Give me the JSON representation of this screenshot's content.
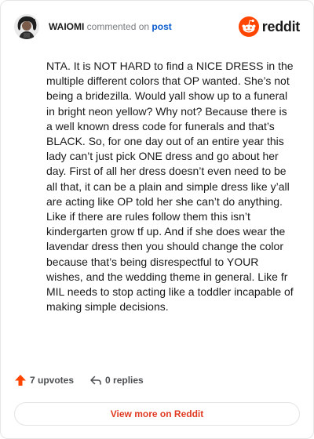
{
  "comment": {
    "author": "WAIOMI",
    "action": "commented on",
    "post_link": "post",
    "body": "NTA. It is NOT HARD to find a NICE DRESS in the multiple different colors that OP wanted. She’s not being a bridezilla. Would yall show up to a funeral in bright neon yellow? Why not? Because there is a well known dress code for funerals and that’s BLACK. So, for one day out of an entire year this lady can’t just pick ONE dress and go about her day. First of all her dress doesn’t even need to be all that, it can be a plain and simple dress like y’all are acting like OP told her she can’t do anything. Like if there are rules follow them this isn’t kindergarten grow tf up. And if she does wear the lavendar dress then you should change the color because that’s being disrespectful to YOUR wishes, and the wedding theme in general. Like fr MIL needs to stop acting like a toddler incapable of making simple decisions."
  },
  "brand": {
    "name": "reddit",
    "accent": "#ff4500"
  },
  "footer": {
    "upvotes": "7 upvotes",
    "replies": "0 replies"
  },
  "view_more_label": "View more on Reddit",
  "icons": {
    "upvote": "upvote-arrow-icon",
    "reply": "reply-arrow-icon",
    "logo": "reddit-snoo-icon"
  },
  "colors": {
    "upvote": "#ff4500",
    "link": "#0a5bcc",
    "cta": "#e03b22"
  }
}
